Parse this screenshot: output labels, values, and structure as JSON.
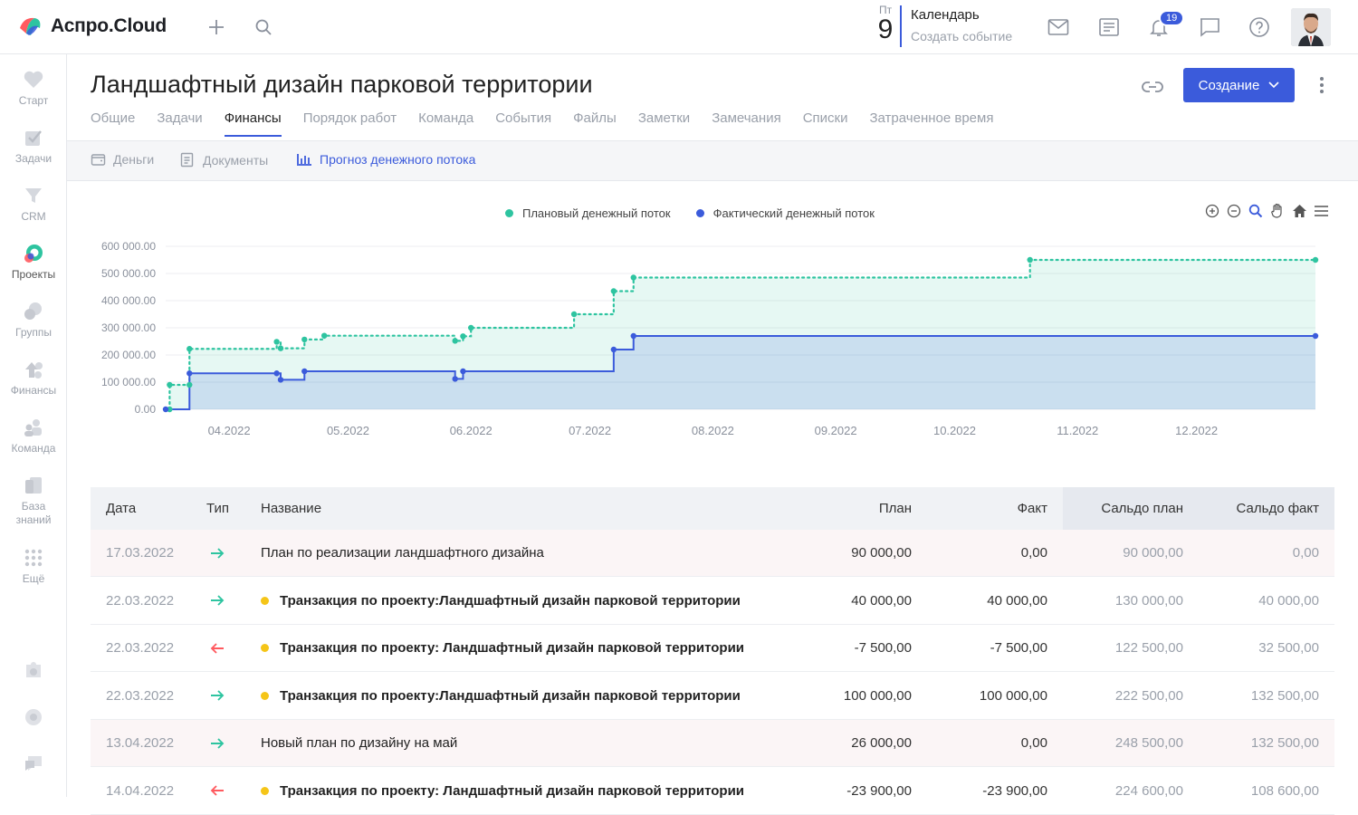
{
  "app": {
    "name": "Аспро.Cloud",
    "brand_color": "#3b5bdb"
  },
  "topbar": {
    "date_dow": "Пт",
    "date_day": "9",
    "calendar_title": "Календарь",
    "calendar_create": "Создать событие",
    "notifications_count": "19"
  },
  "sidebar": {
    "items": [
      {
        "label": "Старт",
        "icon": "heart-icon"
      },
      {
        "label": "Задачи",
        "icon": "check-icon"
      },
      {
        "label": "CRM",
        "icon": "crm-icon"
      },
      {
        "label": "Проекты",
        "icon": "projects-icon"
      },
      {
        "label": "Группы",
        "icon": "groups-icon"
      },
      {
        "label": "Финансы",
        "icon": "finance-icon"
      },
      {
        "label": "Команда",
        "icon": "team-icon"
      },
      {
        "label": "База знаний",
        "icon": "book-icon"
      },
      {
        "label": "Ещё",
        "icon": "grid-icon"
      }
    ]
  },
  "page": {
    "title": "Ландшафтный дизайн парковой территории",
    "create_label": "Создание"
  },
  "tabs": [
    "Общие",
    "Задачи",
    "Финансы",
    "Порядок работ",
    "Команда",
    "События",
    "Файлы",
    "Заметки",
    "Замечания",
    "Списки",
    "Затраченное время"
  ],
  "active_tab": "Финансы",
  "subtabs": [
    {
      "label": "Деньги",
      "icon": "wallet-icon"
    },
    {
      "label": "Документы",
      "icon": "document-icon"
    },
    {
      "label": "Прогноз денежного потока",
      "icon": "bar-chart-icon"
    }
  ],
  "active_subtab": "Прогноз денежного потока",
  "chart_data": {
    "type": "line",
    "legend_position": "top-center",
    "series": [
      {
        "name": "Плановый денежный поток",
        "color": "#2ec4a0",
        "style": "dotted-step",
        "points": [
          [
            "2022-03-17",
            0
          ],
          [
            "2022-03-17",
            90000
          ],
          [
            "2022-03-22",
            90000
          ],
          [
            "2022-03-22",
            222500
          ],
          [
            "2022-04-13",
            248500
          ],
          [
            "2022-04-14",
            224600
          ],
          [
            "2022-04-20",
            257000
          ],
          [
            "2022-04-25",
            271000
          ],
          [
            "2022-05-28",
            252000
          ],
          [
            "2022-05-30",
            269000
          ],
          [
            "2022-06-01",
            300000
          ],
          [
            "2022-06-27",
            350000
          ],
          [
            "2022-07-07",
            435000
          ],
          [
            "2022-07-12",
            485000
          ],
          [
            "2022-10-20",
            550000
          ],
          [
            "2022-12-31",
            550000
          ]
        ]
      },
      {
        "name": "Фактический денежный поток",
        "color": "#3b5bdb",
        "style": "solid-step",
        "points": [
          [
            "2022-03-16",
            0
          ],
          [
            "2022-03-22",
            132500
          ],
          [
            "2022-04-13",
            132500
          ],
          [
            "2022-04-14",
            108600
          ],
          [
            "2022-04-20",
            140000
          ],
          [
            "2022-05-28",
            112000
          ],
          [
            "2022-05-30",
            140000
          ],
          [
            "2022-07-07",
            220000
          ],
          [
            "2022-07-12",
            270000
          ],
          [
            "2022-12-31",
            270000
          ]
        ]
      }
    ],
    "y_ticks": [
      "600 000.00",
      "500 000.00",
      "400 000.00",
      "300 000.00",
      "200 000.00",
      "100 000.00",
      "0.00"
    ],
    "ylim": [
      0,
      600000
    ],
    "x_ticks": [
      "04.2022",
      "05.2022",
      "06.2022",
      "07.2022",
      "08.2022",
      "09.2022",
      "10.2022",
      "11.2022",
      "12.2022"
    ],
    "grid": true
  },
  "table": {
    "headers": {
      "date": "Дата",
      "type": "Тип",
      "name": "Название",
      "plan": "План",
      "fact": "Факт",
      "saldo_plan": "Сальдо план",
      "saldo_fact": "Сальдо факт"
    },
    "rows": [
      {
        "date": "17.03.2022",
        "dir": "in",
        "name": "План по реализации ландшафтного дизайна",
        "bold": false,
        "dot": false,
        "plan": "90 000,00",
        "fact": "0,00",
        "saldo_plan": "90 000,00",
        "saldo_fact": "0,00",
        "highlight": true
      },
      {
        "date": "22.03.2022",
        "dir": "in",
        "name": "Транзакция по проекту:Ландшафтный дизайн парковой территории",
        "bold": true,
        "dot": true,
        "plan": "40 000,00",
        "fact": "40 000,00",
        "saldo_plan": "130 000,00",
        "saldo_fact": "40 000,00",
        "highlight": false
      },
      {
        "date": "22.03.2022",
        "dir": "out",
        "name": "Транзакция по проекту: Ландшафтный дизайн парковой территории",
        "bold": true,
        "dot": true,
        "plan": "-7 500,00",
        "fact": "-7 500,00",
        "saldo_plan": "122 500,00",
        "saldo_fact": "32 500,00",
        "highlight": false
      },
      {
        "date": "22.03.2022",
        "dir": "in",
        "name": "Транзакция по проекту:Ландшафтный дизайн парковой территории",
        "bold": true,
        "dot": true,
        "plan": "100 000,00",
        "fact": "100 000,00",
        "saldo_plan": "222 500,00",
        "saldo_fact": "132 500,00",
        "highlight": false
      },
      {
        "date": "13.04.2022",
        "dir": "in",
        "name": "Новый план по дизайну на май",
        "bold": false,
        "dot": false,
        "plan": "26 000,00",
        "fact": "0,00",
        "saldo_plan": "248 500,00",
        "saldo_fact": "132 500,00",
        "highlight": true
      },
      {
        "date": "14.04.2022",
        "dir": "out",
        "name": "Транзакция по проекту: Ландшафтный дизайн парковой территории",
        "bold": true,
        "dot": true,
        "plan": "-23 900,00",
        "fact": "-23 900,00",
        "saldo_plan": "224 600,00",
        "saldo_fact": "108 600,00",
        "highlight": false
      }
    ]
  }
}
